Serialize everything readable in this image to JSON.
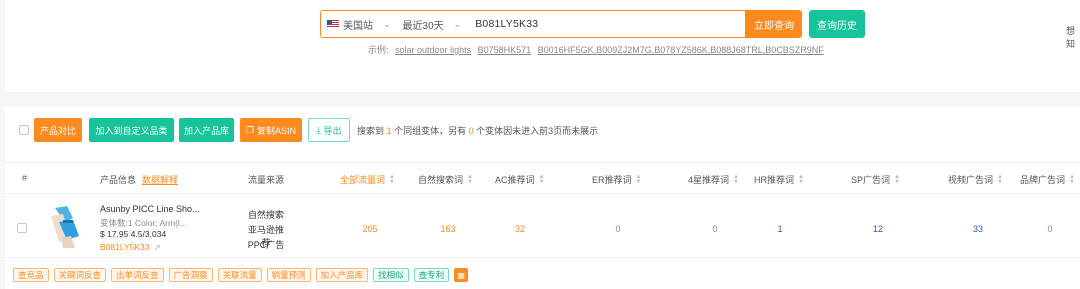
{
  "search": {
    "marketplace": "美国站",
    "range": "最近30天",
    "query": "B081LY5K33",
    "submit_label": "立即查询",
    "history_label": "查询历史",
    "cut_text": "想知",
    "examples_label": "示例:",
    "examples": [
      "solar outdoor lights",
      "B0758HK571",
      "B0016HF5GK,B009ZJ2M7G,B078YZ586K,B088J68TRL,B0CBSZR9NF"
    ]
  },
  "toolbar": {
    "compare": "产品对比",
    "add_custom": "加入到自定义品类",
    "add_library": "加入产品库",
    "copy_asin": "复制ASIN",
    "export": "导出",
    "info_pre": "搜索到",
    "info_count1": "1",
    "info_mid": "个同组变体，另有",
    "info_count2": "0",
    "info_post": "个变体因未进入前3页而未展示"
  },
  "table": {
    "headers": {
      "index": "#",
      "product": "产品信息",
      "explain": "数据解释",
      "source": "流量来源",
      "all": "全部流量词",
      "natural": "自然搜索词",
      "ac": "AC推荐词",
      "er": "ER推荐词",
      "four_star": "4星推荐词",
      "hr": "HR推荐词",
      "sp": "SP广告词",
      "video": "视频广告词",
      "brand": "品牌广告词"
    },
    "row": {
      "name": "Asunby PICC Line Sho...",
      "meta": "变体数:1   Color: Arm(l...",
      "price": "$ 17.95   4.5/3,034",
      "asin": "B081LY5K33",
      "sources": [
        "自然搜索",
        "亚马逊推荐",
        "PPC广告"
      ],
      "values": {
        "all": "205",
        "natural": "163",
        "ac": "32",
        "er": "0",
        "four_star": "0",
        "hr": "1",
        "sp": "12",
        "video": "33",
        "brand": "0"
      }
    },
    "tags": [
      "查竞品",
      "关键词反查",
      "出单词反查",
      "广告洞察",
      "关联流量",
      "销量预测",
      "加入产品库",
      "找相似",
      "查专利"
    ]
  },
  "colors": {
    "accent": "#ff8a1f",
    "green": "#17c39a",
    "blue": "#2d55b5"
  }
}
